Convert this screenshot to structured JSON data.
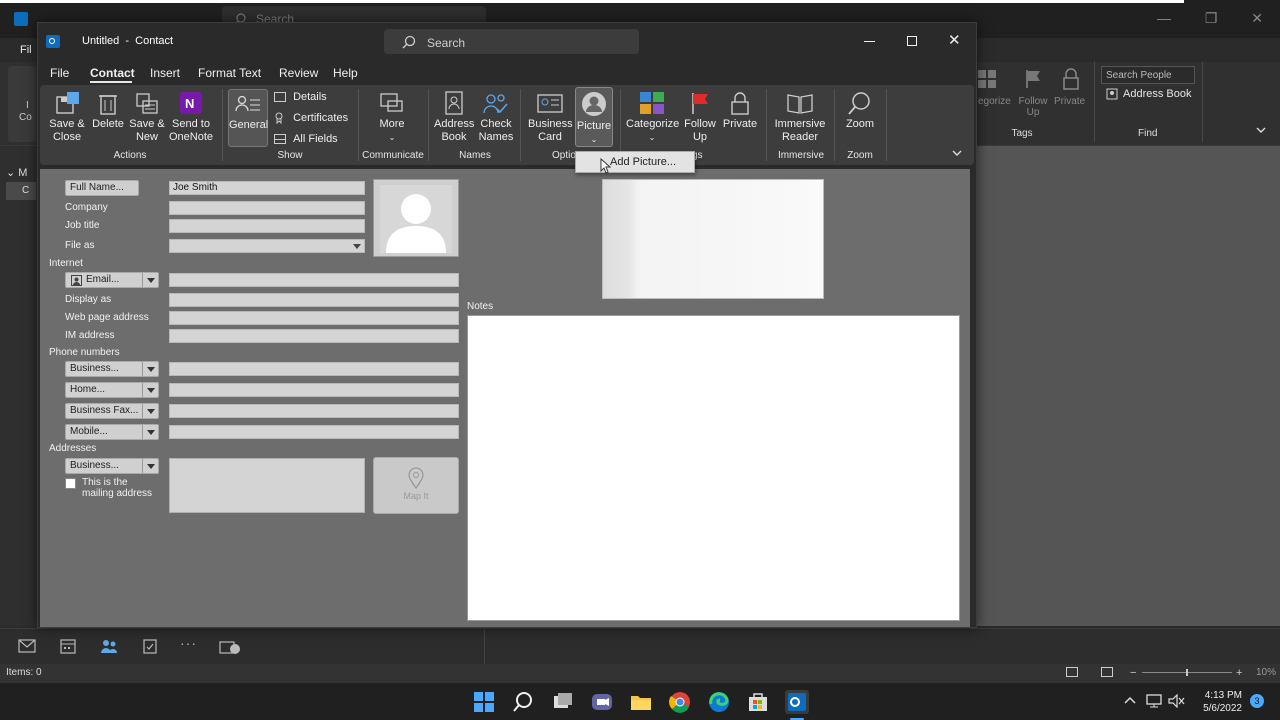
{
  "background": {
    "search_placeholder": "Search",
    "left_labels": [
      "Fil",
      "I",
      "Co",
      "M",
      "C"
    ],
    "ribbon_right": {
      "items": [
        {
          "label": "egorize"
        },
        {
          "label": "Follow",
          "sub": "Up"
        },
        {
          "label": "Private"
        }
      ],
      "tags_label": "Tags",
      "search_people_placeholder": "Search People",
      "address_book_label": "Address Book",
      "find_label": "Find"
    },
    "status_text": "Items: 0",
    "zoom_text": "10%"
  },
  "window": {
    "title": "Untitled  -  Contact",
    "search_placeholder": "Search",
    "menu": [
      "File",
      "Contact",
      "Insert",
      "Format Text",
      "Review",
      "Help"
    ],
    "active_menu": "Contact"
  },
  "ribbon": {
    "save_close": "Save &\nClose",
    "delete": "Delete",
    "save_new": "Save &\nNew",
    "send_onenote": "Send to\nOneNote",
    "general": "General",
    "details": "Details",
    "certificates": "Certificates",
    "all_fields": "All Fields",
    "more": "More",
    "address_book": "Address\nBook",
    "check_names": "Check\nNames",
    "business_card": "Business\nCard",
    "picture": "Picture",
    "categorize": "Categorize",
    "follow_up": "Follow\nUp",
    "private": "Private",
    "immersive_reader": "Immersive\nReader",
    "zoom": "Zoom",
    "groups": {
      "actions": "Actions",
      "show": "Show",
      "communicate": "Communicate",
      "names": "Names",
      "options": "Optio",
      "tags": "gs",
      "immersive": "Immersive",
      "zoom": "Zoom"
    }
  },
  "dropdown": {
    "add_picture": "Add Picture..."
  },
  "form": {
    "full_name_button": "Full Name...",
    "full_name_value": "Joe Smith",
    "company_label": "Company",
    "job_title_label": "Job title",
    "file_as_label": "File as",
    "internet_label": "Internet",
    "email_button": "Email...",
    "display_as_label": "Display as",
    "web_page_label": "Web page address",
    "im_label": "IM address",
    "phone_label": "Phone numbers",
    "phone_buttons": [
      "Business...",
      "Home...",
      "Business Fax...",
      "Mobile..."
    ],
    "addresses_label": "Addresses",
    "address_button": "Business...",
    "mailing_checkbox": "This is the\nmailing address",
    "map_it": "Map It",
    "notes_label": "Notes"
  },
  "taskbar": {
    "time": "4:13 PM",
    "date": "5/6/2022",
    "notification_count": "3"
  }
}
